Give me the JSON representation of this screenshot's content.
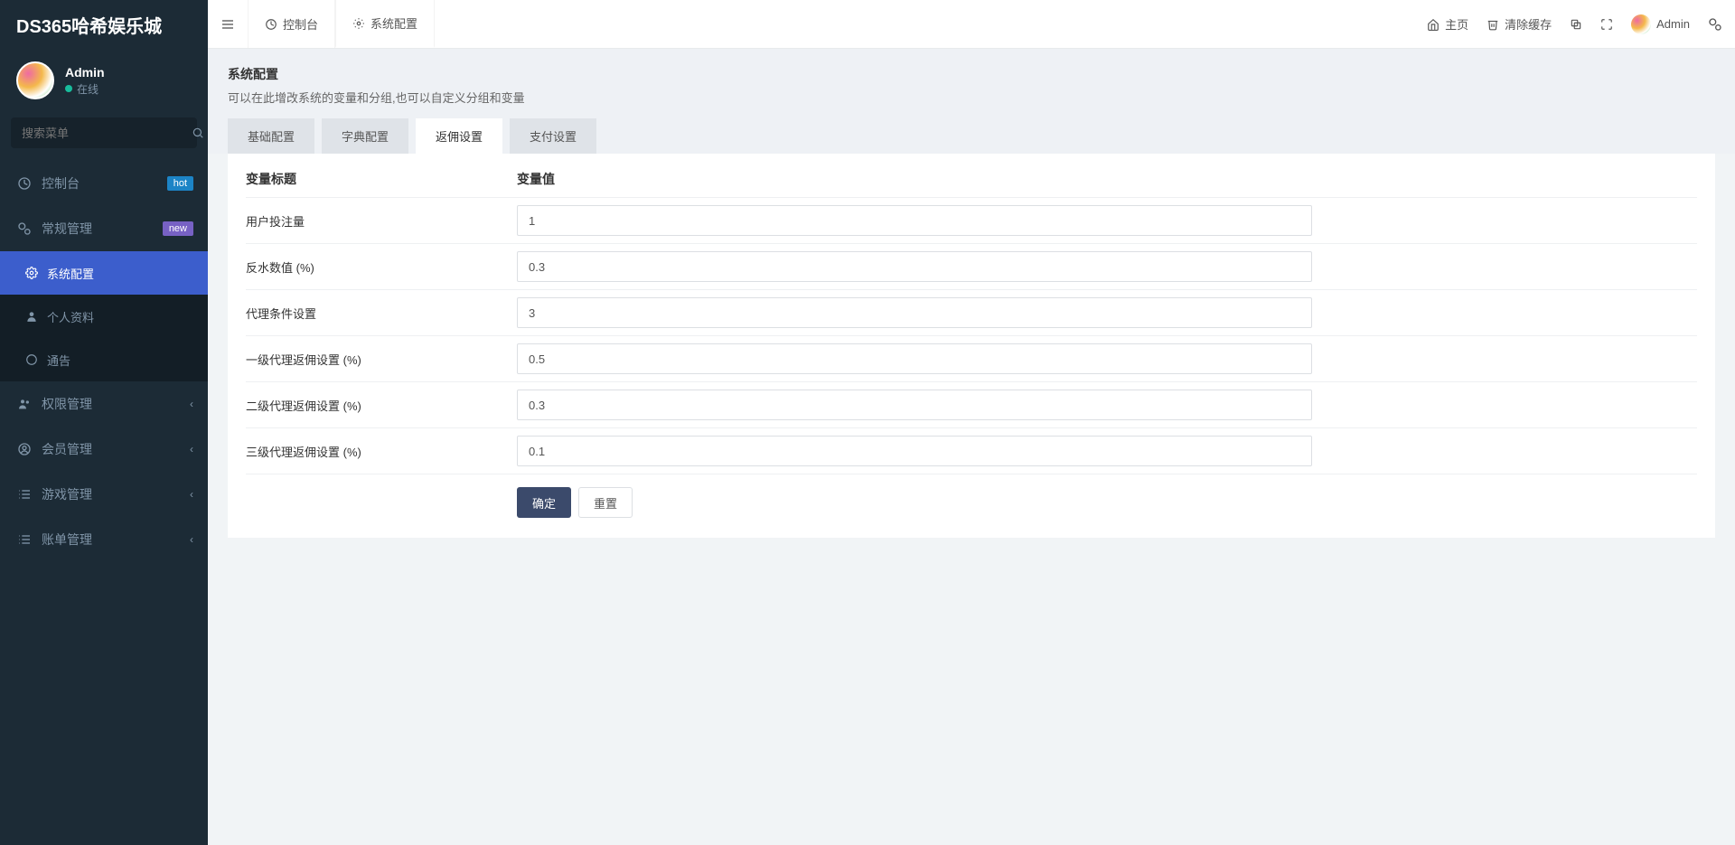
{
  "brand": "DS365哈希娱乐城",
  "user": {
    "name": "Admin",
    "status": "在线"
  },
  "search": {
    "placeholder": "搜索菜单"
  },
  "sidebar": {
    "items": [
      {
        "label": "控制台",
        "badge": "hot"
      },
      {
        "label": "常规管理",
        "badge": "new"
      },
      {
        "label": "系统配置"
      },
      {
        "label": "个人资料"
      },
      {
        "label": "通告"
      },
      {
        "label": "权限管理"
      },
      {
        "label": "会员管理"
      },
      {
        "label": "游戏管理"
      },
      {
        "label": "账单管理"
      }
    ]
  },
  "topbar": {
    "tabs": [
      {
        "label": "控制台"
      },
      {
        "label": "系统配置"
      }
    ],
    "home": "主页",
    "clear_cache": "清除缓存",
    "admin": "Admin"
  },
  "panel": {
    "title": "系统配置",
    "subtitle": "可以在此增改系统的变量和分组,也可以自定义分组和变量"
  },
  "config_tabs": [
    "基础配置",
    "字典配置",
    "返佣设置",
    "支付设置"
  ],
  "table": {
    "headers": {
      "label": "变量标题",
      "value": "变量值"
    },
    "rows": [
      {
        "label": "用户投注量",
        "value": "1"
      },
      {
        "label": "反水数值 (%)",
        "value": "0.3"
      },
      {
        "label": "代理条件设置",
        "value": "3"
      },
      {
        "label": "一级代理返佣设置 (%)",
        "value": "0.5"
      },
      {
        "label": "二级代理返佣设置 (%)",
        "value": "0.3"
      },
      {
        "label": "三级代理返佣设置 (%)",
        "value": "0.1"
      }
    ]
  },
  "actions": {
    "submit": "确定",
    "reset": "重置"
  }
}
